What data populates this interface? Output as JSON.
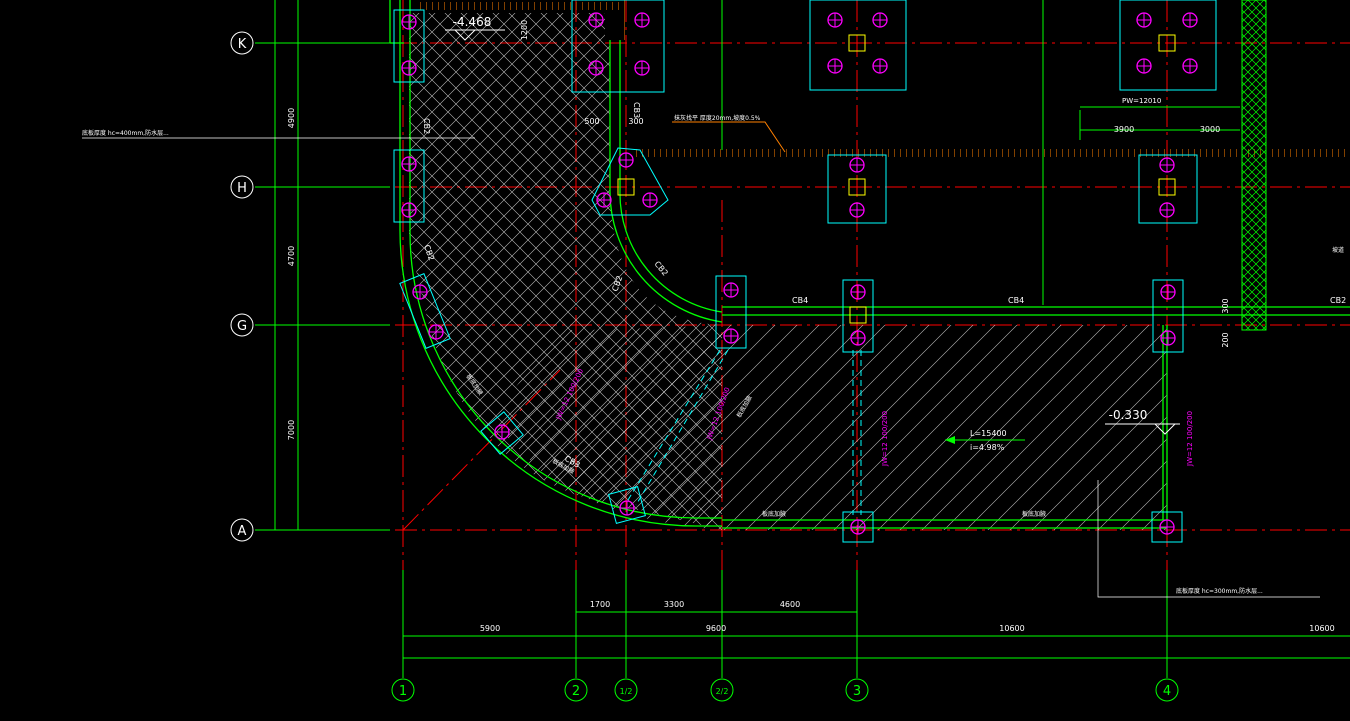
{
  "colors": {
    "background": "#000000",
    "grid_axis": "#00ff00",
    "centerline": "#ff0000",
    "beam": "#00ff00",
    "column": "#00ffff",
    "pile": "#ff00ff",
    "hatch": "#ffffff",
    "rebar_line": "#ff8000",
    "anchor": "#ffff00",
    "text": "#ffffff",
    "magenta_text": "#ff00ff"
  },
  "axis_row_labels": [
    "K",
    "H",
    "G",
    "A"
  ],
  "axis_col_labels": [
    "1",
    "2",
    "1/2",
    "2/2",
    "3",
    "4"
  ],
  "elevations": {
    "top": "-4.468",
    "slab": "-0.330"
  },
  "dims": {
    "left_vertical": [
      "4900",
      "4700",
      "7000"
    ],
    "bottom_row1": [
      "1700",
      "3300",
      "4600"
    ],
    "bottom_row2": [
      "5900",
      "9600",
      "10600",
      "10600"
    ],
    "top_right_span": [
      "3900",
      "3000"
    ],
    "misc": [
      "1200",
      "500",
      "300",
      "300",
      "200"
    ]
  },
  "beam_labels": [
    "CB2",
    "CB3",
    "CB2",
    "CB4",
    "CB4",
    "CB2",
    "CB2",
    "CB2",
    "CB3"
  ],
  "slope_note": "L=15400\ni=4.98%",
  "pile_note": "PW=12010",
  "magenta_notes": [
    "JW=12 100/200",
    "JW=12 100/200",
    "JW=12 100/200",
    "JW=12 100/200"
  ],
  "small_notes": {
    "left_top": "底板厚度 hc=400mm,防水层...\n底板做法详见...",
    "center_top": "抹灰找平 厚度20mm,坡度0.5%\n防水层厚度 1.5mm 详见...",
    "bottom_right": "底板厚度 hc=300mm,防水层...\n底板做法详见...",
    "right_edge": "坡道\n详见"
  },
  "hatch_labels": [
    "板底加腋",
    "板底加腋",
    "板底加腋",
    "板底加腋",
    "板底加腋"
  ]
}
